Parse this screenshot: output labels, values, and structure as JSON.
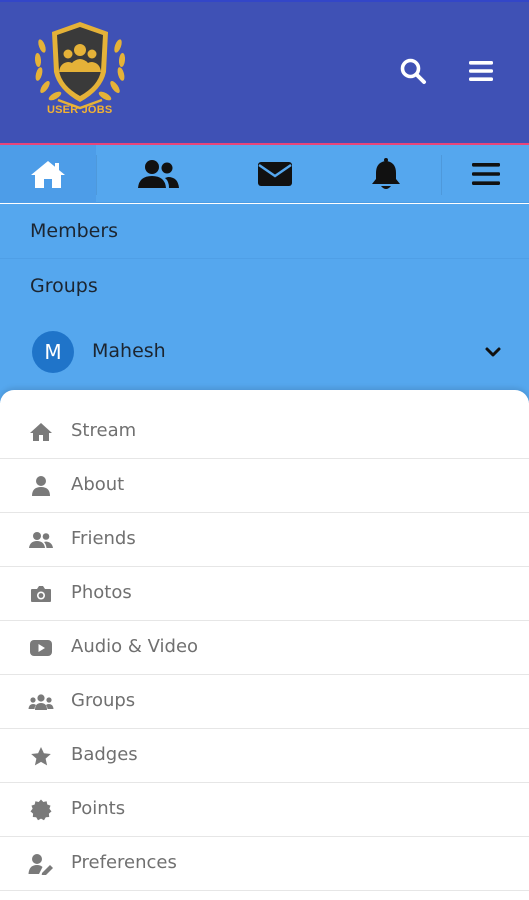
{
  "header": {
    "logo_text": "USER JOBS",
    "icons": [
      "search-icon",
      "hamburger-menu-icon"
    ]
  },
  "nav": {
    "icons": [
      "home-icon",
      "users-icon",
      "envelope-icon",
      "bell-icon",
      "hamburger-menu-icon"
    ]
  },
  "menu": {
    "members": "Members",
    "groups": "Groups"
  },
  "user": {
    "initial": "M",
    "name": "Mahesh"
  },
  "profile_menu": {
    "items": [
      {
        "label": "Stream",
        "icon": "home-icon"
      },
      {
        "label": "About",
        "icon": "user-icon"
      },
      {
        "label": "Friends",
        "icon": "friends-icon"
      },
      {
        "label": "Photos",
        "icon": "camera-icon"
      },
      {
        "label": "Audio & Video",
        "icon": "youtube-play-icon"
      },
      {
        "label": "Groups",
        "icon": "groups-icon"
      },
      {
        "label": "Badges",
        "icon": "star-icon"
      },
      {
        "label": "Points",
        "icon": "certificate-icon"
      },
      {
        "label": "Preferences",
        "icon": "user-edit-icon"
      }
    ]
  },
  "colors": {
    "header_bg": "#3f51b5",
    "nav_bg": "#55a7ee",
    "accent_gold": "#f2b233",
    "avatar_bg": "#1f74c9"
  }
}
